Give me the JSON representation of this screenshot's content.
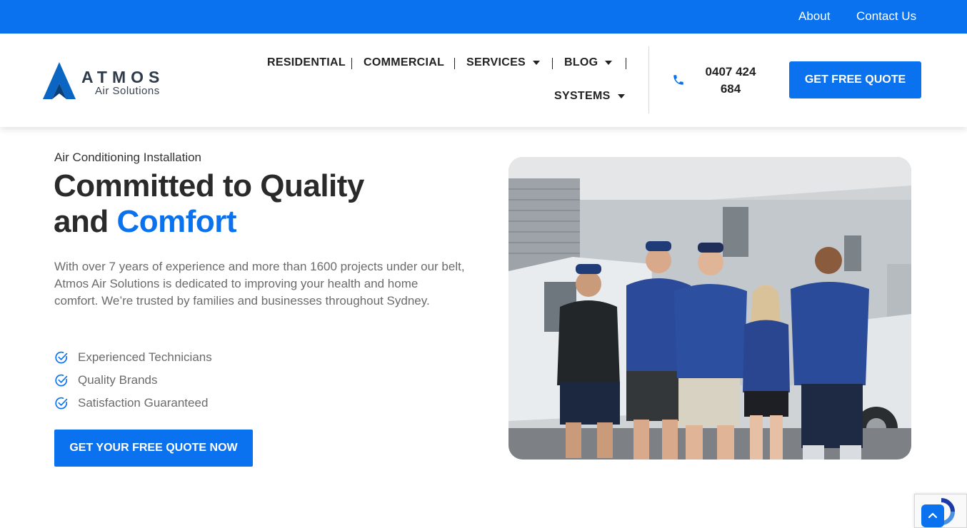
{
  "topbar": {
    "links": [
      "About",
      "Contact Us"
    ]
  },
  "brand": {
    "name": "ATMOS",
    "tagline": "Air Solutions"
  },
  "nav": {
    "items": [
      {
        "label": "RESIDENTIAL",
        "has_dropdown": false
      },
      {
        "label": "COMMERCIAL",
        "has_dropdown": false
      },
      {
        "label": "SERVICES",
        "has_dropdown": true
      },
      {
        "label": "BLOG",
        "has_dropdown": true
      },
      {
        "label": "SYSTEMS",
        "has_dropdown": true
      }
    ]
  },
  "contact": {
    "phone_line1": "0407 424",
    "phone_line2": "684",
    "phone_icon": "phone-icon"
  },
  "header_cta": "GET FREE QUOTE",
  "hero": {
    "eyebrow": "Air Conditioning Installation",
    "headline_part1": "Committed to Quality",
    "headline_part2": "and ",
    "headline_accent": "Comfort",
    "intro": "With over 7 years of experience and more than 1600 projects under our belt, Atmos Air Solutions is dedicated to improving your health and home comfort. We’re trusted by families and businesses throughout Sydney.",
    "features": [
      "Experienced Technicians",
      "Quality Brands",
      "Satisfaction Guaranteed"
    ],
    "cta": "GET YOUR FREE QUOTE NOW"
  },
  "colors": {
    "accent": "#0a72ee",
    "text_dark": "#2a2a2a",
    "text_muted": "#6b6b6b"
  }
}
